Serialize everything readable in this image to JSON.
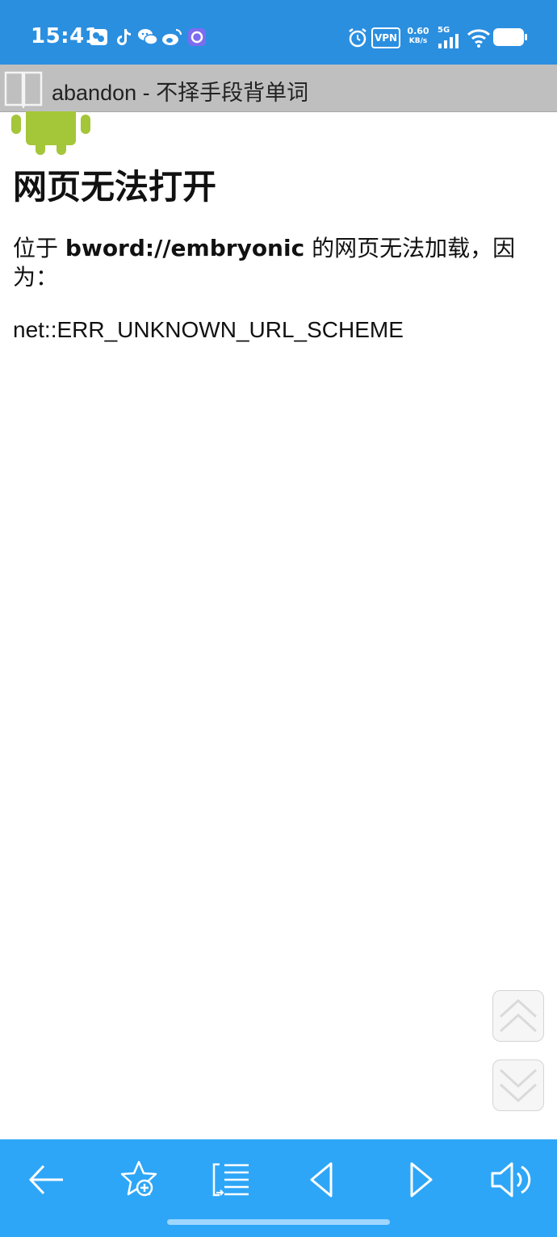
{
  "status_bar": {
    "time": "15:41",
    "vpn_label": "VPN",
    "net_speed_value": "0.60",
    "net_speed_unit": "KB/s",
    "network_type": "5G",
    "icons": [
      "gallery-app-icon",
      "tiktok-icon",
      "wechat-icon",
      "weibo-icon",
      "browser-app-icon",
      "alarm-icon",
      "signal-icon",
      "wifi-icon",
      "battery-icon"
    ]
  },
  "title_bar": {
    "title": "abandon - 不择手段背单词",
    "icon": "book-icon"
  },
  "page": {
    "heading": "网页无法打开",
    "desc_prefix": "位于 ",
    "url": "bword://embryonic",
    "desc_suffix": " 的网页无法加载，因为：",
    "error_code": "net::ERR_UNKNOWN_URL_SCHEME"
  },
  "scroll": {
    "up_icon": "chevron-double-up-icon",
    "down_icon": "chevron-double-down-icon"
  },
  "toolbar": {
    "items": [
      "back-arrow-icon",
      "add-favorite-icon",
      "word-list-icon",
      "previous-icon",
      "next-icon",
      "speaker-icon"
    ]
  },
  "colors": {
    "status_bar": "#2b8fe0",
    "title_bar": "#bfbfbf",
    "toolbar": "#2ea6f7",
    "android_green": "#a4c639"
  }
}
